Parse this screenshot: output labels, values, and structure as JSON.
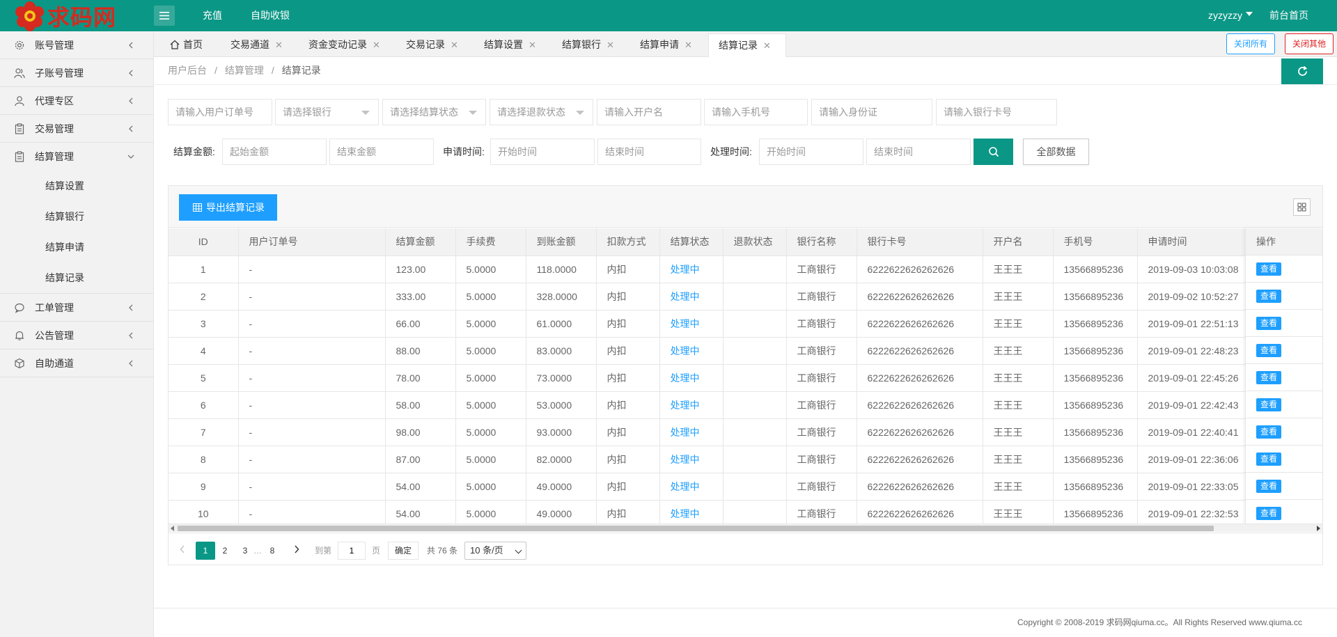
{
  "brand": {
    "logo_text": "求码网"
  },
  "header": {
    "nav": [
      "充值",
      "自助收银"
    ],
    "user": "zyzyzzy",
    "front_home": "前台首页"
  },
  "sidebar": {
    "items": [
      {
        "label": "账号管理",
        "icon": "gear-icon"
      },
      {
        "label": "子账号管理",
        "icon": "users-icon"
      },
      {
        "label": "代理专区",
        "icon": "user-icon"
      },
      {
        "label": "交易管理",
        "icon": "clipboard-icon"
      },
      {
        "label": "结算管理",
        "icon": "clipboard-icon",
        "expanded": true,
        "children": [
          "结算设置",
          "结算银行",
          "结算申请",
          "结算记录"
        ]
      },
      {
        "label": "工单管理",
        "icon": "chat-icon"
      },
      {
        "label": "公告管理",
        "icon": "bell-icon"
      },
      {
        "label": "自助通道",
        "icon": "cube-icon"
      }
    ]
  },
  "tabs": [
    {
      "label": "首页",
      "closable": false
    },
    {
      "label": "交易通道",
      "closable": true
    },
    {
      "label": "资金变动记录",
      "closable": true
    },
    {
      "label": "交易记录",
      "closable": true
    },
    {
      "label": "结算设置",
      "closable": true
    },
    {
      "label": "结算银行",
      "closable": true
    },
    {
      "label": "结算申请",
      "closable": true
    },
    {
      "label": "结算记录",
      "closable": true,
      "active": true
    }
  ],
  "tab_actions": {
    "close_all": "关闭所有",
    "close_other": "关闭其他"
  },
  "breadcrumb": [
    "用户后台",
    "结算管理",
    "结算记录"
  ],
  "filters": {
    "order_no": "请输入用户订单号",
    "bank": "请选择银行",
    "settle_status": "请选择结算状态",
    "refund_status": "请选择退款状态",
    "account_name": "请输入开户名",
    "phone": "请输入手机号",
    "id_card": "请输入身份证",
    "bank_card": "请输入银行卡号",
    "amount_label": "结算金额:",
    "amount_start": "起始金额",
    "amount_end": "结束金额",
    "apply_label": "申请时间:",
    "apply_start": "开始时间",
    "apply_end": "结束时间",
    "process_label": "处理时间:",
    "process_start": "开始时间",
    "process_end": "结束时间",
    "all_data": "全部数据"
  },
  "toolbar": {
    "export_label": "导出结算记录"
  },
  "table": {
    "columns": [
      "ID",
      "用户订单号",
      "结算金额",
      "手续费",
      "到账金额",
      "扣款方式",
      "结算状态",
      "退款状态",
      "银行名称",
      "银行卡号",
      "开户名",
      "手机号",
      "申请时间",
      "操作"
    ],
    "rows": [
      [
        "1",
        "-",
        "123.00",
        "5.0000",
        "118.0000",
        "内扣",
        "处理中",
        "",
        "工商银行",
        "6222622626262626",
        "王王王",
        "13566895236",
        "2019-09-03 10:03:08"
      ],
      [
        "2",
        "-",
        "333.00",
        "5.0000",
        "328.0000",
        "内扣",
        "处理中",
        "",
        "工商银行",
        "6222622626262626",
        "王王王",
        "13566895236",
        "2019-09-02 10:52:27"
      ],
      [
        "3",
        "-",
        "66.00",
        "5.0000",
        "61.0000",
        "内扣",
        "处理中",
        "",
        "工商银行",
        "6222622626262626",
        "王王王",
        "13566895236",
        "2019-09-01 22:51:13"
      ],
      [
        "4",
        "-",
        "88.00",
        "5.0000",
        "83.0000",
        "内扣",
        "处理中",
        "",
        "工商银行",
        "6222622626262626",
        "王王王",
        "13566895236",
        "2019-09-01 22:48:23"
      ],
      [
        "5",
        "-",
        "78.00",
        "5.0000",
        "73.0000",
        "内扣",
        "处理中",
        "",
        "工商银行",
        "6222622626262626",
        "王王王",
        "13566895236",
        "2019-09-01 22:45:26"
      ],
      [
        "6",
        "-",
        "58.00",
        "5.0000",
        "53.0000",
        "内扣",
        "处理中",
        "",
        "工商银行",
        "6222622626262626",
        "王王王",
        "13566895236",
        "2019-09-01 22:42:43"
      ],
      [
        "7",
        "-",
        "98.00",
        "5.0000",
        "93.0000",
        "内扣",
        "处理中",
        "",
        "工商银行",
        "6222622626262626",
        "王王王",
        "13566895236",
        "2019-09-01 22:40:41"
      ],
      [
        "8",
        "-",
        "87.00",
        "5.0000",
        "82.0000",
        "内扣",
        "处理中",
        "",
        "工商银行",
        "6222622626262626",
        "王王王",
        "13566895236",
        "2019-09-01 22:36:06"
      ],
      [
        "9",
        "-",
        "54.00",
        "5.0000",
        "49.0000",
        "内扣",
        "处理中",
        "",
        "工商银行",
        "6222622626262626",
        "王王王",
        "13566895236",
        "2019-09-01 22:33:05"
      ],
      [
        "10",
        "-",
        "54.00",
        "5.0000",
        "49.0000",
        "内扣",
        "处理中",
        "",
        "工商银行",
        "6222622626262626",
        "王王王",
        "13566895236",
        "2019-09-01 22:32:53"
      ]
    ],
    "view_label": "查看"
  },
  "pagination": {
    "pages": [
      "1",
      "2",
      "3",
      "…",
      "8"
    ],
    "current": "1",
    "goto_label": "到第",
    "goto_value": "1",
    "page_unit": "页",
    "confirm": "确定",
    "total": "共 76 条",
    "page_size": "10 条/页"
  },
  "footer": {
    "copyright": "Copyright © 2008-2019 求码网qiuma.cc。All Rights Reserved www.qiuma.cc"
  },
  "colors": {
    "primary": "#0b9786",
    "accent_blue": "#1e9fff",
    "danger": "#e02020",
    "logo_red": "#d42a1f"
  }
}
